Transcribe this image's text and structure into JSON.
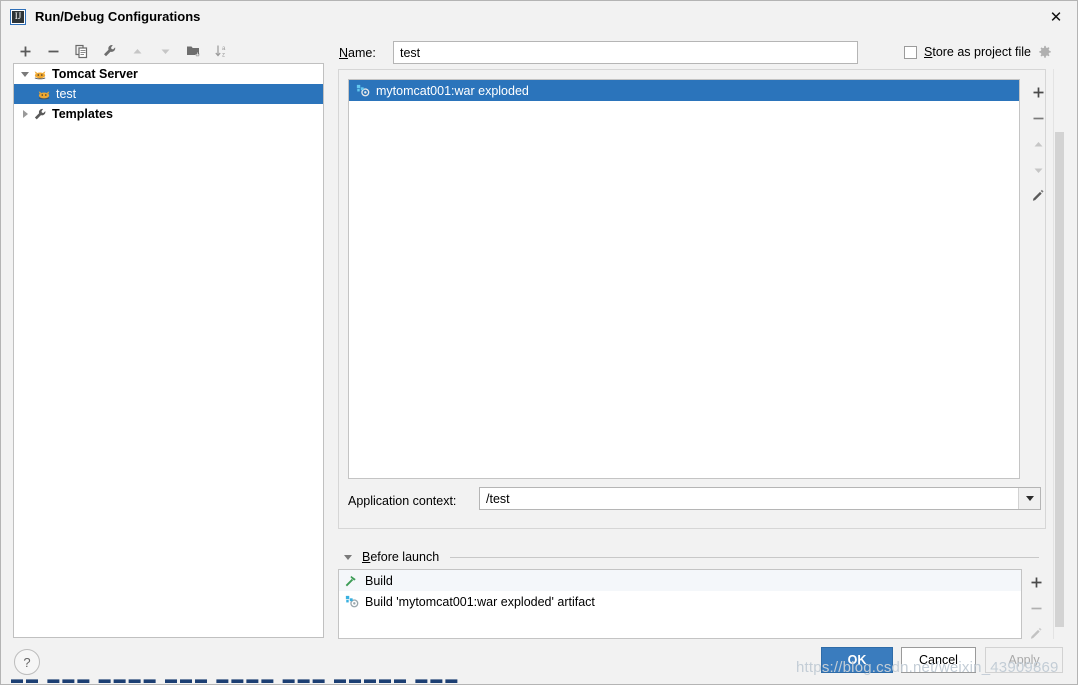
{
  "window": {
    "title": "Run/Debug Configurations",
    "app_icon": "intellij-idea-icon",
    "app_icon_text": "IJ",
    "close_label": "✕"
  },
  "left_toolbar": {
    "buttons": [
      {
        "name": "add-configuration-button",
        "icon": "plus-icon",
        "label": "+",
        "enabled": true
      },
      {
        "name": "remove-configuration-button",
        "icon": "minus-icon",
        "label": "−",
        "enabled": true
      },
      {
        "name": "copy-configuration-button",
        "icon": "copy-icon",
        "label": "Copy",
        "enabled": true
      },
      {
        "name": "edit-templates-button",
        "icon": "wrench-icon",
        "label": "Edit Templates",
        "enabled": true
      },
      {
        "name": "move-up-button",
        "icon": "arrow-up-icon",
        "label": "Move Up",
        "enabled": false
      },
      {
        "name": "move-down-button",
        "icon": "arrow-down-icon",
        "label": "Move Down",
        "enabled": false
      },
      {
        "name": "new-folder-button",
        "icon": "folder-add-icon",
        "label": "New Folder",
        "enabled": true
      },
      {
        "name": "sort-configurations-button",
        "icon": "sort-alpha-icon",
        "label": "Sort",
        "enabled": true
      }
    ]
  },
  "tree": {
    "nodes": [
      {
        "label": "Tomcat Server",
        "icon": "tomcat-icon",
        "expanded": true,
        "selected": false,
        "bold": true,
        "level": 0
      },
      {
        "label": "test",
        "icon": "tomcat-icon",
        "expanded": null,
        "selected": true,
        "bold": false,
        "level": 1
      },
      {
        "label": "Templates",
        "icon": "wrench-icon",
        "expanded": false,
        "selected": false,
        "bold": true,
        "level": 0
      }
    ]
  },
  "name_field": {
    "label_prefix": "",
    "label_mnemonic": "N",
    "label_suffix": "ame:",
    "value": "test",
    "placeholder": ""
  },
  "store_as_project_file": {
    "checked": false,
    "label_mnemonic": "S",
    "label_suffix": "tore as project file",
    "gear_icon": "gear-icon"
  },
  "deployment": {
    "items": [
      {
        "label": "mytomcat001:war exploded",
        "icon": "artifact-icon",
        "selected": true
      }
    ],
    "toolbar": [
      {
        "name": "add-artifact-button",
        "icon": "plus-icon",
        "label": "+",
        "enabled": true
      },
      {
        "name": "remove-artifact-button",
        "icon": "minus-icon",
        "label": "−",
        "enabled": true
      },
      {
        "name": "artifact-move-up-button",
        "icon": "arrow-up-icon",
        "label": "Move Up",
        "enabled": false
      },
      {
        "name": "artifact-move-down-button",
        "icon": "arrow-down-icon",
        "label": "Move Down",
        "enabled": false
      },
      {
        "name": "edit-artifact-button",
        "icon": "pencil-icon",
        "label": "Edit",
        "enabled": true
      }
    ]
  },
  "application_context": {
    "label": "Application context:",
    "value": "/test",
    "dropdown_icon": "chevron-down-icon"
  },
  "before_launch": {
    "expanded": true,
    "title_mnemonic": "B",
    "title_suffix": "efore launch",
    "items": [
      {
        "label": "Build",
        "icon": "build-hammer-icon"
      },
      {
        "label": "Build 'mytomcat001:war exploded' artifact",
        "icon": "artifact-icon"
      }
    ],
    "toolbar": [
      {
        "name": "add-before-launch-task-button",
        "icon": "plus-icon",
        "label": "+",
        "enabled": true
      },
      {
        "name": "remove-before-launch-task-button",
        "icon": "minus-icon",
        "label": "−",
        "enabled": true
      },
      {
        "name": "edit-before-launch-task-button",
        "icon": "pencil-icon",
        "label": "Edit",
        "enabled": false
      }
    ]
  },
  "footer": {
    "help_label": "?",
    "ok_label": "OK",
    "cancel_label": "Cancel",
    "apply_label": "Apply",
    "apply_enabled": false
  },
  "watermark": {
    "text": "https://blog.csdn.net/weixin_43909869"
  },
  "background_text": {
    "text": "▬▬ ▬▬▬ ▬▬▬▬ ▬▬▬ ▬▬▬▬ ▬▬▬ ▬▬▬▬▬ ▬▬▬"
  },
  "colors": {
    "selection_blue": "#2b74bb",
    "ok_button": "#3a7cbe",
    "dialog_bg": "#f2f2f2",
    "panel_bg": "#ffffff",
    "watermark": "#c3cdd6"
  }
}
